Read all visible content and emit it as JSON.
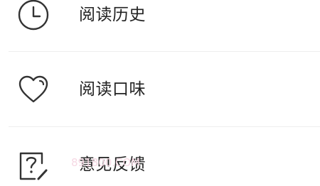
{
  "menu": {
    "items": [
      {
        "label": "阅读历史",
        "icon": "clock-icon"
      },
      {
        "label": "阅读口味",
        "icon": "heart-icon"
      },
      {
        "label": "意见反馈",
        "icon": "feedback-icon"
      }
    ]
  },
  "watermark": {
    "text": "891800.COM"
  },
  "colors": {
    "text": "#222222",
    "icon_stroke": "#333333",
    "divider": "#eeeeee",
    "background": "#ffffff",
    "watermark": "#f6d9e4"
  }
}
